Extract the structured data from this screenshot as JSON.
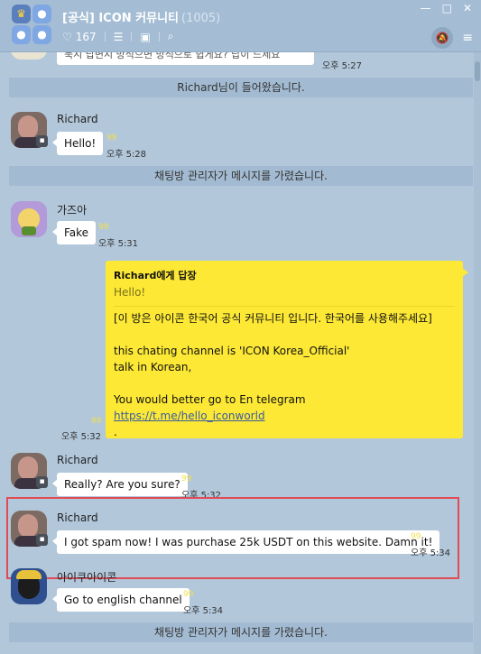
{
  "window": {
    "room_title": "[공식] ICON 커뮤니티",
    "member_count": "(1005)",
    "likes": "167",
    "controls": [
      "—",
      "□",
      "✕"
    ]
  },
  "icons": {
    "heart": "♡",
    "notice": "☰",
    "album": "▣",
    "search": "⌕",
    "mute": "🔕",
    "menu": "≡"
  },
  "partial": {
    "text": "묵시 답변시 방식으면 방식으로 쉽게요? 답이 드세요",
    "time": "오후 5:27"
  },
  "messages": {
    "notice1": "Richard님이 들어왔습니다.",
    "m1": {
      "sender": "Richard",
      "text": "Hello!",
      "unread": "99",
      "time": "오후 5:28"
    },
    "notice2": "채팅방 관리자가 메시지를 가렸습니다.",
    "m2": {
      "sender": "가즈아",
      "text": "Fake",
      "unread": "99",
      "time": "오후 5:31"
    },
    "reply": {
      "to": "Richard에게 답장",
      "quote": "Hello!",
      "line1": "[이 방은 아이콘 한국어 공식 커뮤니티 입니다. 한국어를 사용해주세요]",
      "line2": "this chating channel is 'ICON Korea_Official'",
      "line3": "talk in Korean,",
      "line4": "You would better go to En telegram",
      "link": "https://t.me/hello_iconworld",
      "line5": ".",
      "unread": "99",
      "time": "오후 5:32"
    },
    "m3": {
      "sender": "Richard",
      "text": "Really? Are you sure?",
      "unread": "99",
      "time": "오후 5:32"
    },
    "m4": {
      "sender": "Richard",
      "text": "I got spam now! I was purchase 25k USDT on this website. Damn it!",
      "unread": "99",
      "time": "오후 5:34"
    },
    "m5": {
      "sender": "아이쿠아이콘",
      "text": "Go to english channel",
      "unread": "99",
      "time": "오후 5:34"
    },
    "notice3": "채팅방 관리자가 메시지를 가렸습니다."
  },
  "colors": {
    "chat_background": "#b2c7da",
    "my_bubble": "#fde935",
    "highlight_box": "#e04b56"
  }
}
